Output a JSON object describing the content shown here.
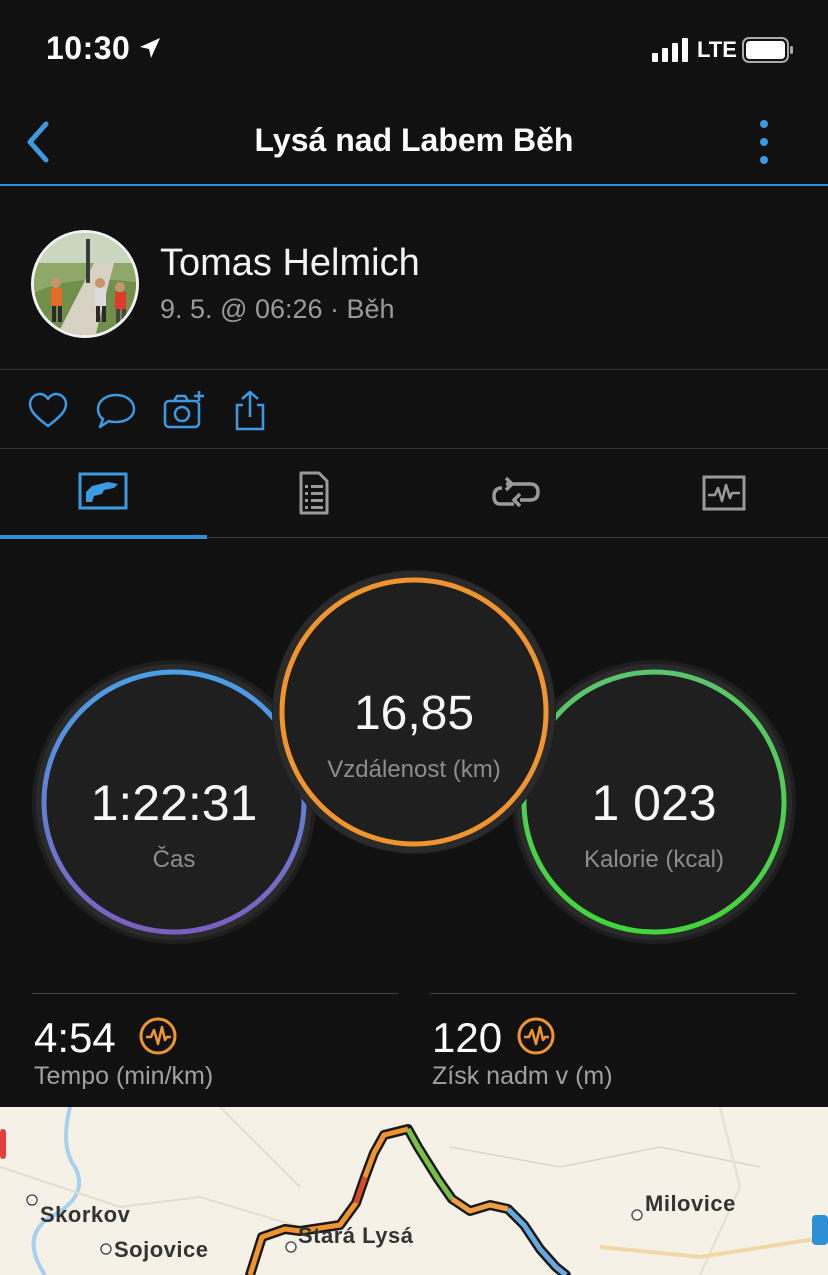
{
  "status": {
    "time": "10:30",
    "network": "LTE"
  },
  "nav": {
    "title": "Lysá nad Labem Běh"
  },
  "profile": {
    "name": "Tomas Helmich",
    "meta": "9. 5. @ 06:26 · Běh"
  },
  "actions": [
    "heart-icon",
    "comment-icon",
    "add-photo-icon",
    "share-icon"
  ],
  "tabs": [
    {
      "icon": "stats-icon",
      "selected": true
    },
    {
      "icon": "details-icon",
      "selected": false
    },
    {
      "icon": "laps-icon",
      "selected": false
    },
    {
      "icon": "chart-icon",
      "selected": false
    }
  ],
  "metrics": {
    "time": {
      "value": "1:22:31",
      "label": "Čas"
    },
    "distance": {
      "value": "16,85",
      "label": "Vzdálenost (km)"
    },
    "calories": {
      "value": "1 023",
      "label": "Kalorie (kcal)"
    }
  },
  "stats": {
    "pace": {
      "value": "4:54",
      "label": "Tempo (min/km)"
    },
    "elevation": {
      "value": "120",
      "label": "Získ nadm v (m)"
    }
  },
  "map": {
    "places": [
      "Skorkov",
      "Sojovice",
      "Stará Lysá",
      "Milovice"
    ]
  },
  "colors": {
    "accent": "#2d8fd6",
    "time_ring": [
      "#4a9fe6",
      "#7d5fc0"
    ],
    "distance_ring": "#f0952e",
    "calories_ring": [
      "#5cc46e",
      "#42d63a"
    ],
    "badge": "#f0952e"
  }
}
